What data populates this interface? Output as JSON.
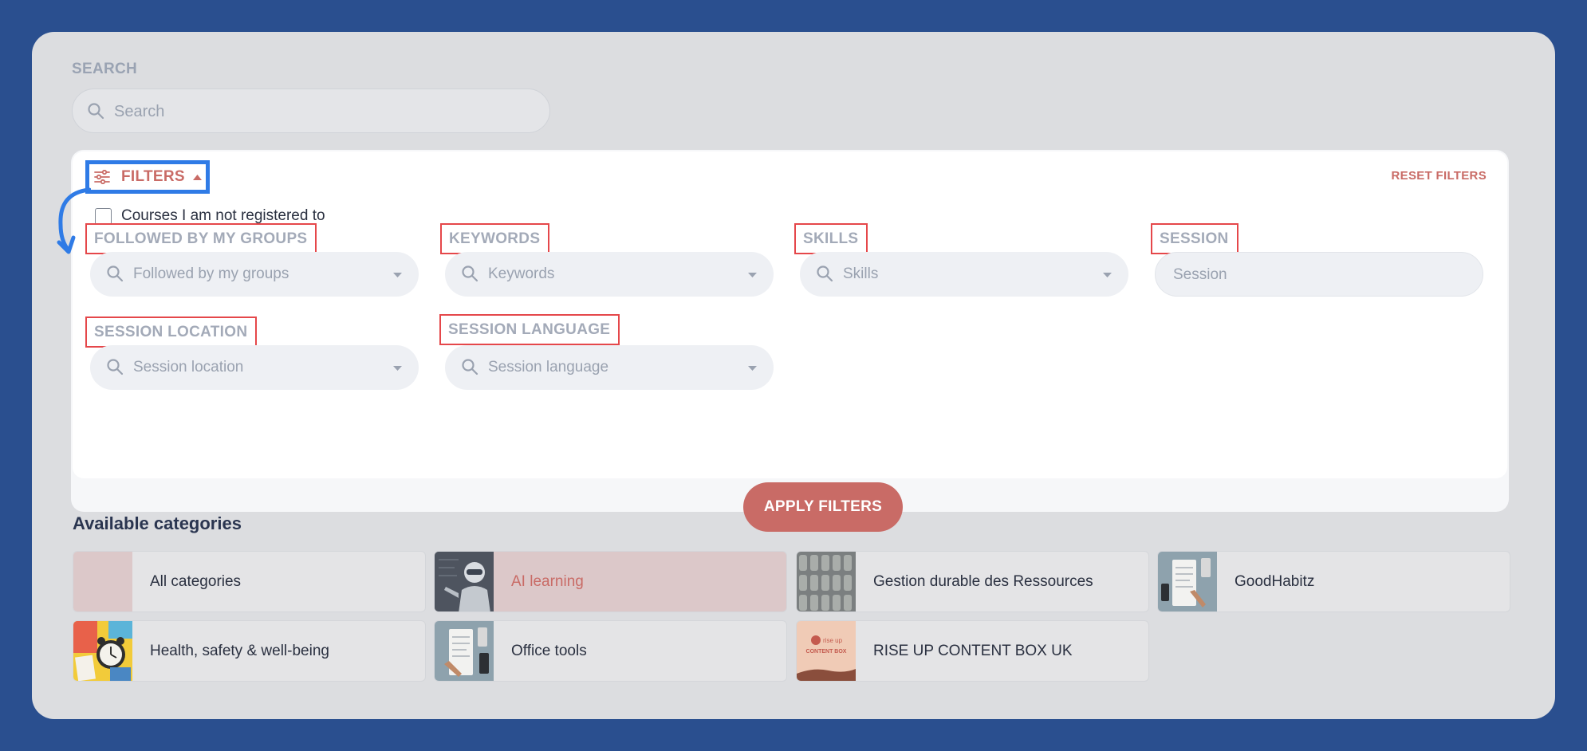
{
  "search": {
    "label": "SEARCH",
    "placeholder": "Search"
  },
  "filters": {
    "toggle_label": "FILTERS",
    "reset_label": "RESET FILTERS",
    "checkbox_label": "Courses I am not registered to",
    "fields": [
      {
        "label": "FOLLOWED BY MY GROUPS",
        "placeholder": "Followed by my groups"
      },
      {
        "label": "KEYWORDS",
        "placeholder": "Keywords"
      },
      {
        "label": "SKILLS",
        "placeholder": "Skills"
      },
      {
        "label": "SESSION",
        "placeholder": "Session"
      },
      {
        "label": "SESSION LOCATION",
        "placeholder": "Session location"
      },
      {
        "label": "SESSION LANGUAGE",
        "placeholder": "Session language"
      }
    ],
    "apply_label": "APPLY FILTERS"
  },
  "categories": {
    "title": "Available categories",
    "items": [
      {
        "name": "All categories",
        "active": false
      },
      {
        "name": "AI learning",
        "active": true
      },
      {
        "name": "Gestion durable des Ressources",
        "active": false
      },
      {
        "name": "GoodHabitz",
        "active": false
      },
      {
        "name": "Health, safety & well-being",
        "active": false
      },
      {
        "name": "Office tools",
        "active": false
      },
      {
        "name": "RISE UP CONTENT BOX UK",
        "active": false
      }
    ],
    "thumb_text": {
      "rise_small": "rise up",
      "rise_big": "CONTENT BOX"
    }
  },
  "colors": {
    "accent": "#c96b66",
    "highlight_box": "#2f7be6",
    "annotation_red": "#e5474a",
    "background": "#2a4f8f"
  }
}
